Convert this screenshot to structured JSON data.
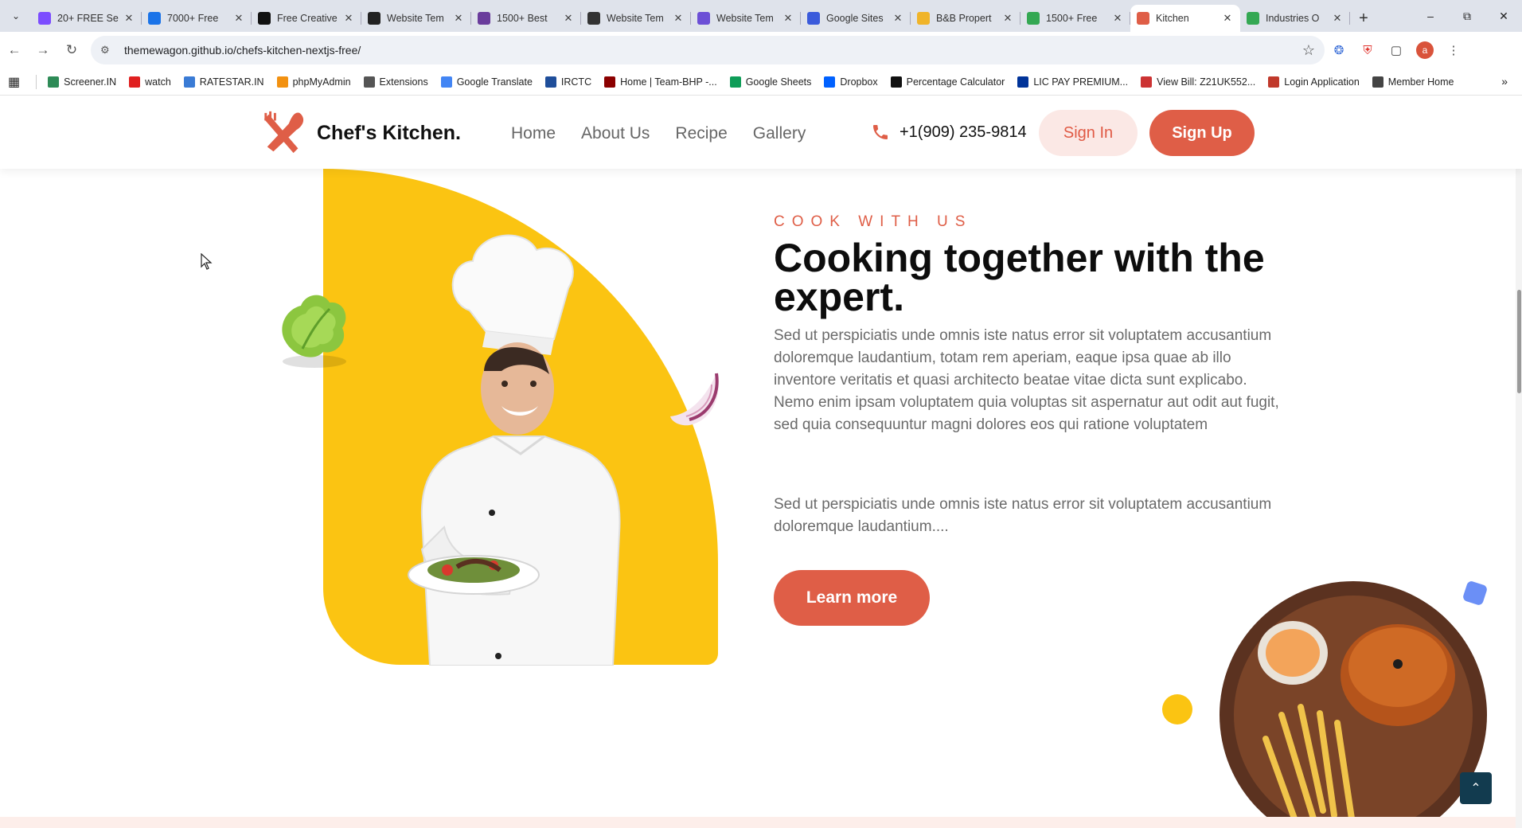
{
  "browser": {
    "tabs": [
      {
        "label": "20+ FREE Se",
        "color": "#7c4dff"
      },
      {
        "label": "7000+ Free",
        "color": "#1a73e8"
      },
      {
        "label": "Free Creative",
        "color": "#111111"
      },
      {
        "label": "Website Tem",
        "color": "#222222"
      },
      {
        "label": "1500+ Best",
        "color": "#6a3c9c"
      },
      {
        "label": "Website Tem",
        "color": "#333333"
      },
      {
        "label": "Website Tem",
        "color": "#6c4fd6"
      },
      {
        "label": "Google Sites",
        "color": "#3b5bdb"
      },
      {
        "label": "B&B Propert",
        "color": "#f0b429"
      },
      {
        "label": "1500+ Free",
        "color": "#34a853"
      },
      {
        "label": "Kitchen",
        "color": "#df5e47"
      },
      {
        "label": "Industries O",
        "color": "#34a853"
      }
    ],
    "active_tab_index": 10,
    "url": "themewagon.github.io/chefs-kitchen-nextjs-free/",
    "profile_initial": "a",
    "bookmarks": [
      {
        "label": "Screener.IN",
        "color": "#2e8b57"
      },
      {
        "label": "watch",
        "color": "#e02020"
      },
      {
        "label": "RATESTAR.IN",
        "color": "#3a7bd5"
      },
      {
        "label": "phpMyAdmin",
        "color": "#f29111"
      },
      {
        "label": "Extensions",
        "color": "#555555"
      },
      {
        "label": "Google Translate",
        "color": "#4285f4"
      },
      {
        "label": "IRCTC",
        "color": "#1f4e9a"
      },
      {
        "label": "Home | Team-BHP -...",
        "color": "#8b0000"
      },
      {
        "label": "Google Sheets",
        "color": "#0f9d58"
      },
      {
        "label": "Dropbox",
        "color": "#0061ff"
      },
      {
        "label": "Percentage Calculator",
        "color": "#111111"
      },
      {
        "label": "LIC PAY PREMIUM...",
        "color": "#003399"
      },
      {
        "label": "View Bill: Z21UK552...",
        "color": "#cc3333"
      },
      {
        "label": "Login Application",
        "color": "#c0392b"
      },
      {
        "label": "Member Home",
        "color": "#444444"
      }
    ]
  },
  "site": {
    "brand": "Chef's Kitchen.",
    "nav": [
      "Home",
      "About Us",
      "Recipe",
      "Gallery"
    ],
    "phone": "+1(909) 235-9814",
    "signin_label": "Sign In",
    "signup_label": "Sign Up",
    "accent_color": "#df5e47",
    "yellow_color": "#fbc412"
  },
  "hero": {
    "eyebrow": "COOK WITH US",
    "headline": "Cooking together with the expert.",
    "paragraph1": "Sed ut perspiciatis unde omnis iste natus error sit voluptatem accusantium doloremque laudantium, totam rem aperiam, eaque ipsa quae ab illo inventore veritatis et quasi architecto beatae vitae dicta sunt explicabo. Nemo enim ipsam voluptatem quia voluptas sit aspernatur aut odit aut fugit, sed quia consequuntur magni dolores eos qui ratione voluptatem",
    "paragraph2": "Sed ut perspiciatis unde omnis iste natus error sit voluptatem accusantium doloremque laudantium....",
    "cta_label": "Learn more"
  }
}
